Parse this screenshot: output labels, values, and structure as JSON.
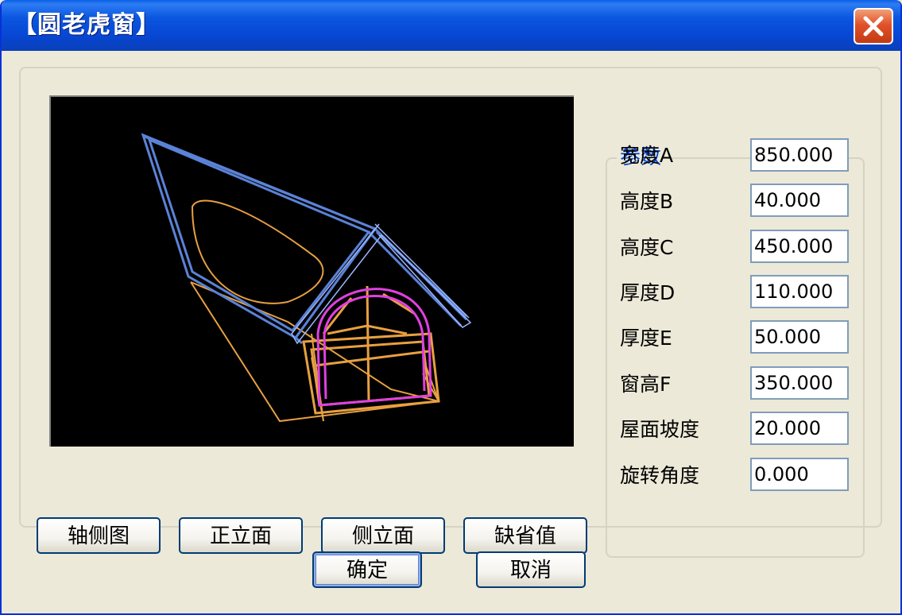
{
  "window": {
    "title": "【圆老虎窗】",
    "close_icon": "close-icon"
  },
  "preview": {
    "description_icon": "dormer-wireframe"
  },
  "view_buttons": [
    {
      "label": "轴侧图"
    },
    {
      "label": "正立面"
    },
    {
      "label": "侧立面"
    },
    {
      "label": "缺省值"
    }
  ],
  "params": {
    "legend": "参数",
    "fields": [
      {
        "label": "宽度A",
        "value": "850.000"
      },
      {
        "label": "高度B",
        "value": "40.000"
      },
      {
        "label": "高度C",
        "value": "450.000"
      },
      {
        "label": "厚度D",
        "value": "110.000"
      },
      {
        "label": "厚度E",
        "value": "50.000"
      },
      {
        "label": "窗高F",
        "value": "350.000"
      },
      {
        "label": "屋面坡度",
        "value": "20.000"
      },
      {
        "label": "旋转角度",
        "value": "0.000"
      }
    ]
  },
  "footer": {
    "ok_label": "确定",
    "cancel_label": "取消"
  },
  "colors": {
    "accent": "#0831d9",
    "legend": "#0046d5",
    "roof": "#5b82d6",
    "frame": "#e8a040",
    "arch": "#e040e0"
  }
}
